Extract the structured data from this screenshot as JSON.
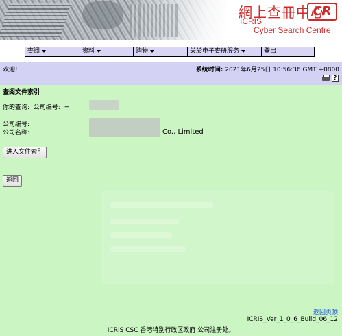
{
  "banner": {
    "brand_zh": "網上查冊中心",
    "brand_logo": "CR",
    "brand_en_1": "ICRIS",
    "brand_en_2": "Cyber Search Centre"
  },
  "menu": {
    "items": [
      {
        "label": "查阅",
        "has_dropdown": true
      },
      {
        "label": "资料",
        "has_dropdown": true
      },
      {
        "label": "购物",
        "has_dropdown": true
      },
      {
        "label": "关於电子查册服务",
        "has_dropdown": true
      },
      {
        "label": "登出",
        "has_dropdown": false
      }
    ]
  },
  "header": {
    "welcome": "欢迎!",
    "systime_label": "系统时间:",
    "systime_value": "2021年6月25日 10:56:36 GMT +0800"
  },
  "main": {
    "title": "查阅文件索引",
    "query_label": "你的查询:",
    "query_field": "公司编号:",
    "query_operator": "=",
    "company_no_label": "公司编号:",
    "company_name_label": "公司名称:",
    "company_name_suffix": "Co., Limited",
    "index_button": "进入文件索引",
    "back_button": "返回"
  },
  "footer": {
    "back_top": "返回页顶",
    "version": "ICRIS_Ver_1_0_6_Build_06_12",
    "copyright": "ICRIS CSC 香港特别行政区政府 公司注册处。"
  },
  "colors": {
    "menu_bg": "#d9d5f5",
    "welcome_bg": "#d3d1f4",
    "content_bg": "#ccf5c4",
    "brand_red": "#cc2a2a",
    "link_blue": "#1a4fd6"
  }
}
